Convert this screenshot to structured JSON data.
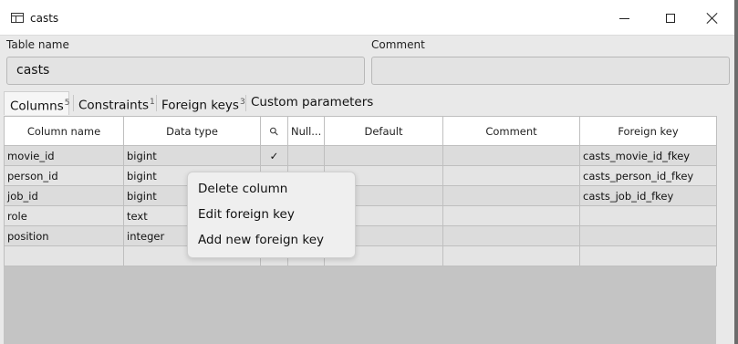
{
  "window": {
    "title": "casts"
  },
  "form": {
    "table_name_label": "Table name",
    "table_name_value": "casts",
    "comment_label": "Comment",
    "comment_value": ""
  },
  "tabs": [
    {
      "label": "Columns",
      "count": "5"
    },
    {
      "label": "Constraints",
      "count": "1"
    },
    {
      "label": "Foreign keys",
      "count": "3"
    },
    {
      "label": "Custom parameters",
      "count": ""
    }
  ],
  "grid": {
    "columns": [
      "Column name",
      "Data type",
      "key-icon",
      "Null...",
      "Default",
      "Comment",
      "Foreign key"
    ],
    "rows": [
      {
        "name": "movie_id",
        "type": "bigint",
        "pk": "✓",
        "nullable": "",
        "default": "",
        "comment": "",
        "fk": "casts_movie_id_fkey"
      },
      {
        "name": "person_id",
        "type": "bigint",
        "pk": "✓",
        "nullable": "",
        "default": "",
        "comment": "",
        "fk": "casts_person_id_fkey"
      },
      {
        "name": "job_id",
        "type": "bigint",
        "pk": "",
        "nullable": "",
        "default": "",
        "comment": "",
        "fk": "casts_job_id_fkey"
      },
      {
        "name": "role",
        "type": "text",
        "pk": "",
        "nullable": "",
        "default": "",
        "comment": "",
        "fk": ""
      },
      {
        "name": "position",
        "type": "integer",
        "pk": "",
        "nullable": "",
        "default": "",
        "comment": "",
        "fk": ""
      },
      {
        "name": "",
        "type": "",
        "pk": "",
        "nullable": "",
        "default": "",
        "comment": "",
        "fk": ""
      }
    ]
  },
  "context_menu": {
    "items": [
      "Delete column",
      "Edit foreign key",
      "Add new foreign key"
    ]
  }
}
